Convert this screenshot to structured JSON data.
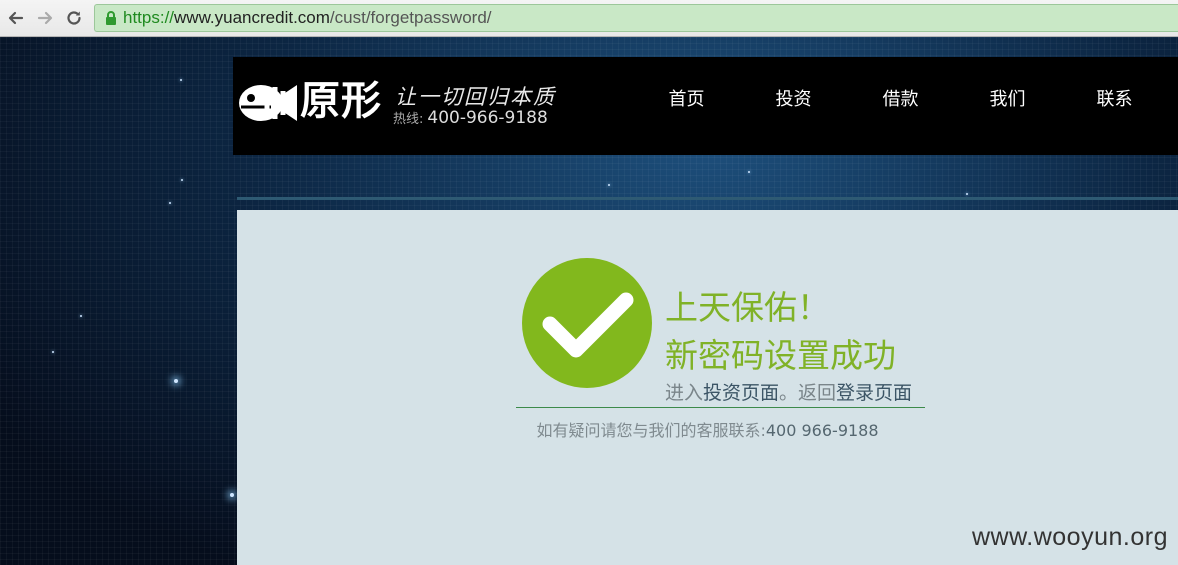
{
  "browser": {
    "url_scheme": "https://",
    "url_host": "www.yuancredit.com",
    "url_path": "/cust/forgetpassword/"
  },
  "header": {
    "logo_text": "原形",
    "slogan": "让一切回归本质",
    "hotline_label": "热线:",
    "hotline_number": "400-966-9188",
    "nav": [
      "首页",
      "投资",
      "借款",
      "我们",
      "联系"
    ]
  },
  "main": {
    "title_line1": "上天保佑！",
    "title_line2": "新密码设置成功",
    "link_prefix": "进入",
    "invest_link": "投资页面",
    "link_middle": "。返回",
    "login_link": "登录页面",
    "contact_text": "如有疑问请您与我们的客服联系:",
    "contact_phone": "400 966-9188"
  },
  "watermark": "www.wooyun.org",
  "colors": {
    "success_green": "#82b81d",
    "panel_bg": "#d5e2e7",
    "header_bg": "#000000",
    "url_bar_bg": "#c9e8c6"
  },
  "icons": [
    "back-arrow-icon",
    "forward-arrow-icon",
    "reload-icon",
    "lock-icon",
    "fish-logo-icon",
    "checkmark-icon"
  ]
}
